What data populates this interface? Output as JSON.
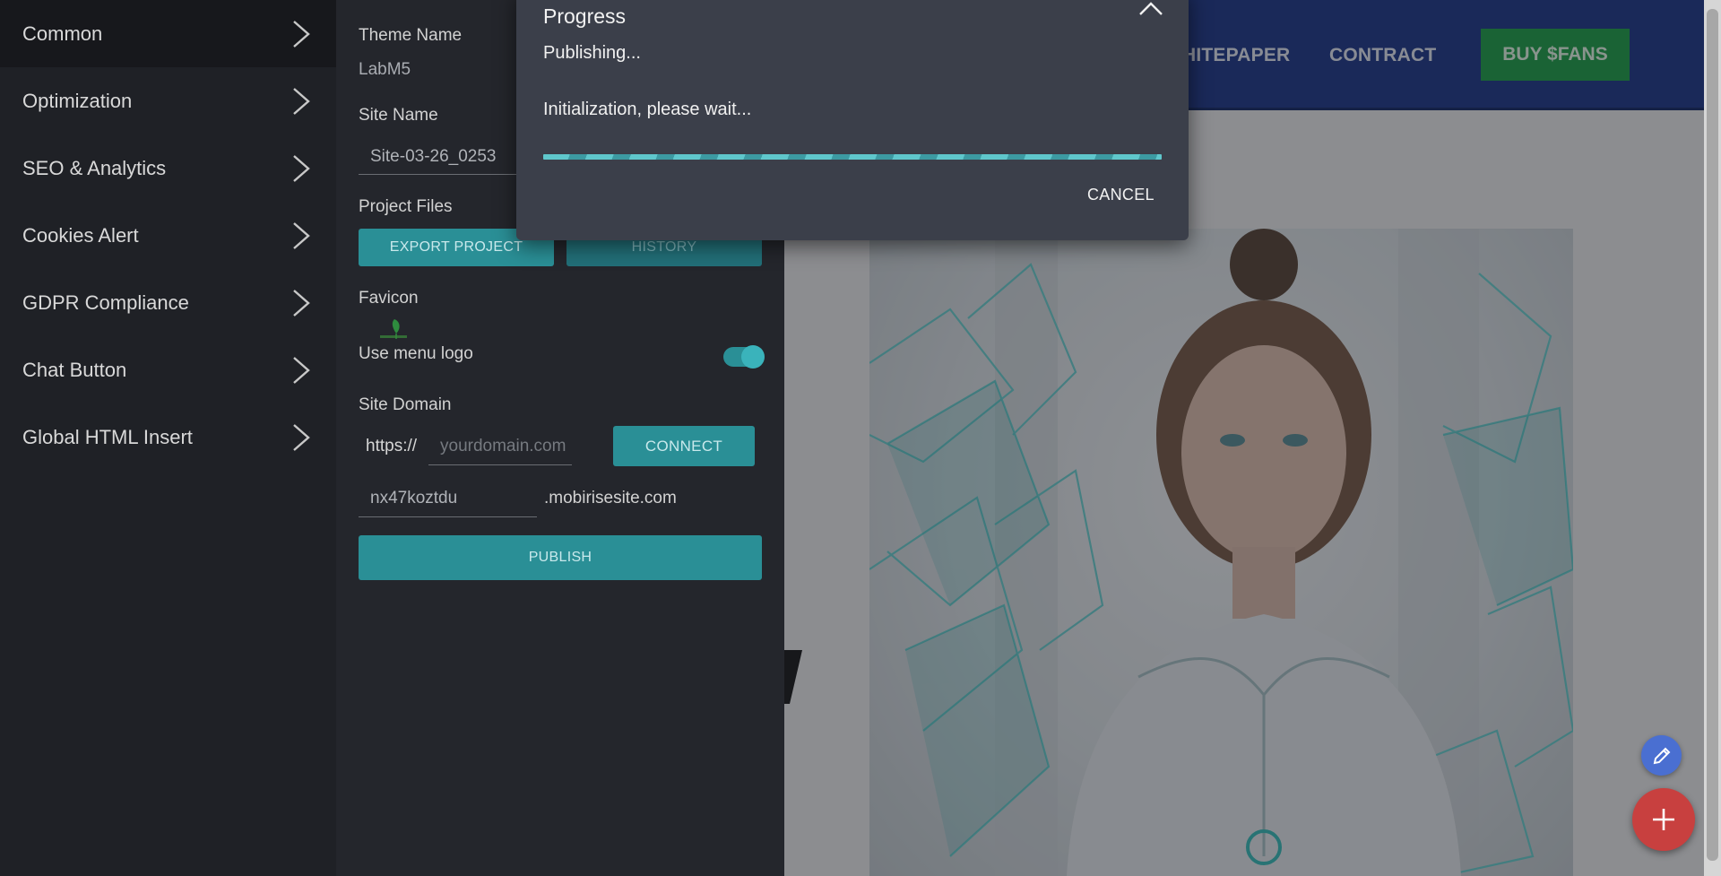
{
  "sidebar": {
    "items": [
      {
        "label": "Common"
      },
      {
        "label": "Optimization"
      },
      {
        "label": "SEO & Analytics"
      },
      {
        "label": "Cookies Alert"
      },
      {
        "label": "GDPR Compliance"
      },
      {
        "label": "Chat Button"
      },
      {
        "label": "Global HTML Insert"
      }
    ]
  },
  "settings": {
    "theme_name_label": "Theme Name",
    "theme_name_value": "LabM5",
    "site_name_label": "Site Name",
    "site_name_value": "Site-03-26_0253",
    "project_files_label": "Project Files",
    "export_button": "EXPORT PROJECT",
    "history_button": "HISTORY",
    "favicon_label": "Favicon",
    "use_menu_logo_label": "Use menu logo",
    "use_menu_logo_on": true,
    "site_domain_label": "Site Domain",
    "protocol": "https://",
    "domain_placeholder": "yourdomain.com",
    "connect_button": "CONNECT",
    "subdomain_value": "nx47koztdu",
    "subdomain_suffix": ".mobirisesite.com",
    "publish_button": "PUBLISH"
  },
  "dialog": {
    "title": "Progress",
    "status": "Publishing...",
    "message": "Initialization, please wait...",
    "progress_percent": 100,
    "cancel_button": "CANCEL"
  },
  "preview": {
    "nav_links": [
      "HITEPAPER",
      "CONTRACT"
    ],
    "buy_button": "BUY $FANS"
  },
  "colors": {
    "accent": "#2a8f96",
    "site_nav": "#1f3a8a",
    "buy_button": "#1fa34a",
    "fab_add": "#c8403f",
    "fab_edit": "#4a6fd1"
  },
  "icons": {
    "nav_chevron": "chevron-right-icon",
    "dialog_close": "close-icon",
    "fab_edit": "pencil-icon",
    "fab_add": "plus-icon"
  }
}
